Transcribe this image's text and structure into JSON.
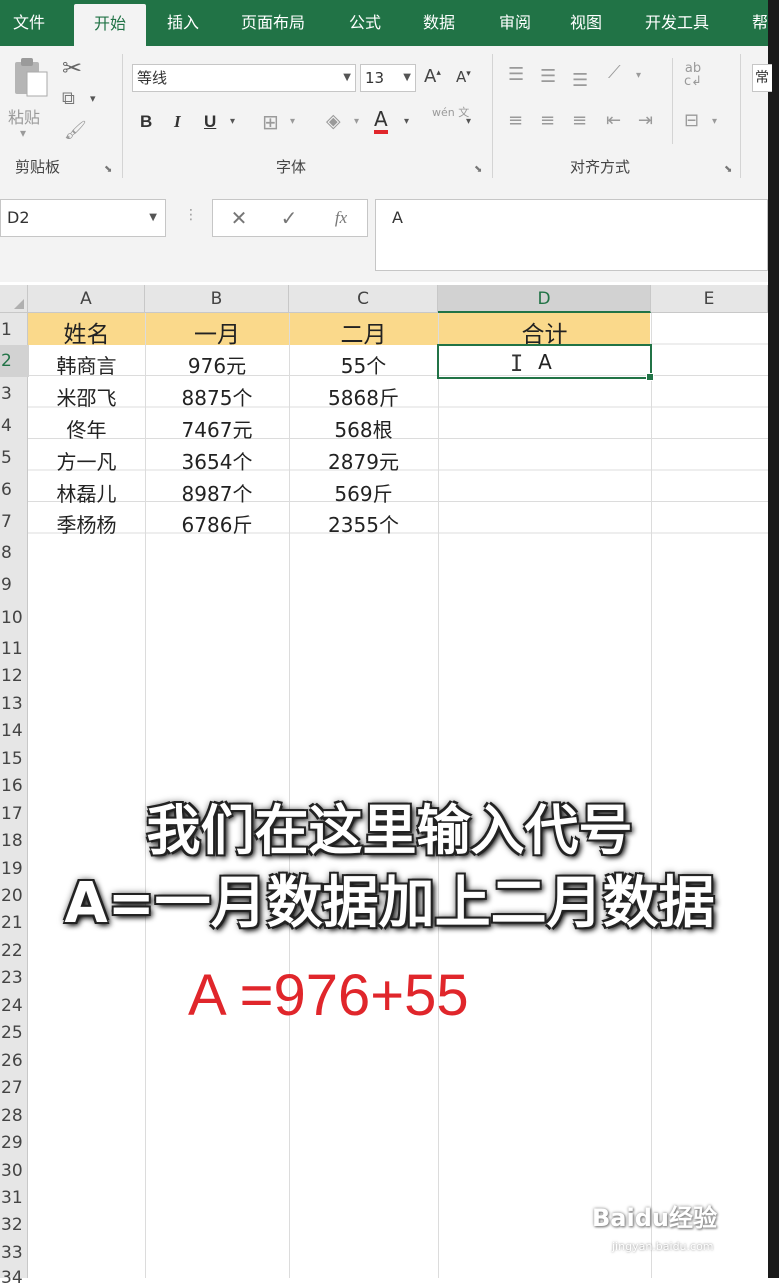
{
  "tabs": [
    "文件",
    "开始",
    "插入",
    "页面布局",
    "公式",
    "数据",
    "审阅",
    "视图",
    "开发工具",
    "帮"
  ],
  "active_tab": "开始",
  "clipboard": {
    "paste_label": "粘贴",
    "group_label": "剪贴板"
  },
  "font": {
    "name": "等线",
    "size": "13",
    "group_label": "字体",
    "phonetic": "wén 文"
  },
  "alignment": {
    "group_label": "对齐方式"
  },
  "number_partial": "常",
  "formula_bar": {
    "name_box": "D2",
    "fx": "fx",
    "content": "A"
  },
  "columns": [
    "A",
    "B",
    "C",
    "D",
    "E"
  ],
  "selected_column": "D",
  "rows": [
    "1",
    "2",
    "3",
    "4",
    "5",
    "6",
    "7",
    "8",
    "9",
    "10",
    "11",
    "12",
    "13",
    "14",
    "15",
    "16",
    "17",
    "18",
    "19",
    "20",
    "21",
    "22",
    "23",
    "24",
    "25",
    "26",
    "27",
    "28",
    "29",
    "30",
    "31",
    "32",
    "33",
    "34"
  ],
  "table": {
    "header": [
      "姓名",
      "一月",
      "二月",
      "合计"
    ],
    "data": [
      [
        "韩商言",
        "976元",
        "55个",
        "A"
      ],
      [
        "米邵飞",
        "8875个",
        "5868斤",
        ""
      ],
      [
        "佟年",
        "7467元",
        "568根",
        ""
      ],
      [
        "方一凡",
        "3654个",
        "2879元",
        ""
      ],
      [
        "林磊儿",
        "8987个",
        "569斤",
        ""
      ],
      [
        "季杨杨",
        "6786斤",
        "2355个",
        ""
      ]
    ]
  },
  "caption_line1": "我们在这里输入代号",
  "caption_line2": "A=一月数据加上二月数据",
  "formula_overlay": "A =976+55",
  "watermark": "Baidu经验",
  "watermark_url": "jingyan.baidu.com",
  "colors": {
    "excel_green": "#217346",
    "header_fill": "#fad98b",
    "formula_red": "#e0262b"
  }
}
